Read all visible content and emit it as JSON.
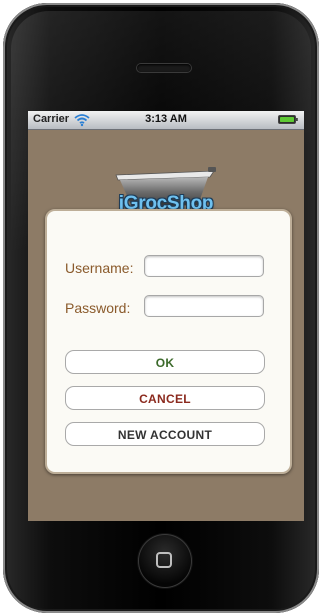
{
  "status_bar": {
    "carrier": "Carrier",
    "time": "3:13 AM",
    "wifi_icon": "wifi-icon",
    "battery_icon": "battery-icon",
    "battery_color": "#5ec934"
  },
  "app": {
    "logo_text": "iGrocShop",
    "logo_color": "#6fc1ef",
    "background_color": "#8d7b66"
  },
  "login_form": {
    "username_label": "Username:",
    "password_label": "Password:",
    "username_value": "",
    "password_value": "",
    "buttons": {
      "ok": "OK",
      "cancel": "CANCEL",
      "new_account": "NEW ACCOUNT"
    }
  },
  "colors": {
    "label_text": "#8a5a2b",
    "ok_text": "#3c6a2b",
    "cancel_text": "#8b2a1e"
  }
}
